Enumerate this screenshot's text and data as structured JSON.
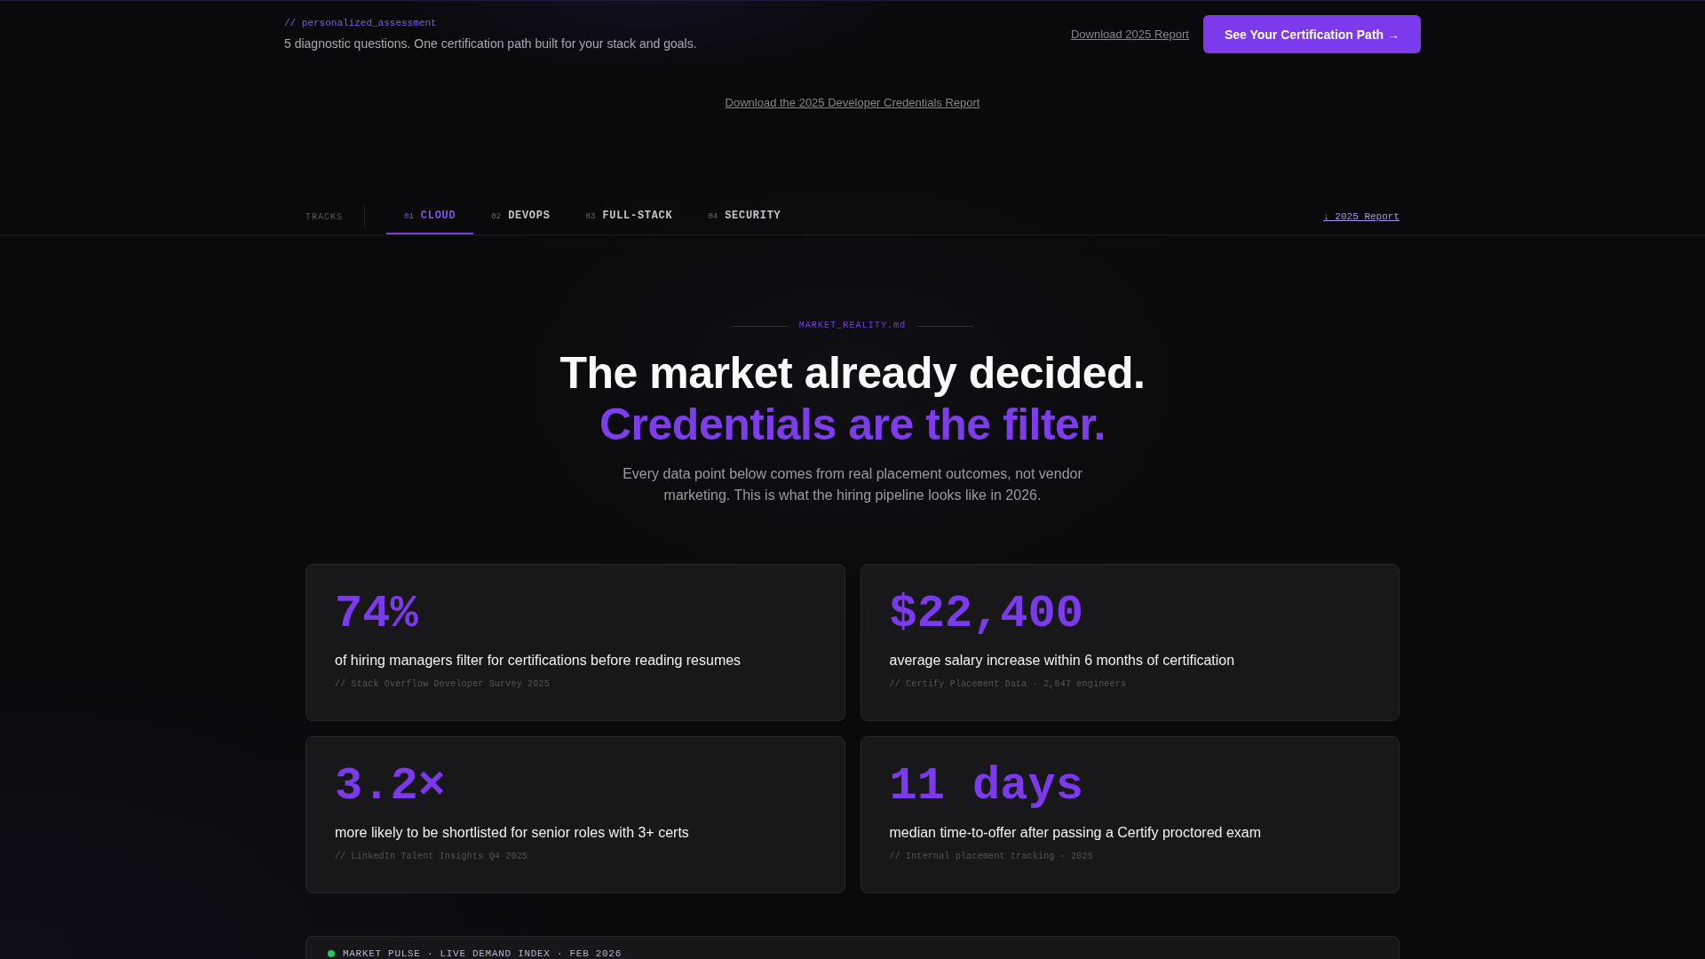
{
  "top_bar": {
    "eyebrow": "// personalized_assessment",
    "subtitle": "5 diagnostic questions. One certification path built for your stack and goals.",
    "link": "Download 2025 Report",
    "button": "See Your Certification Path →"
  },
  "report_link": "Download the 2025 Developer Credentials Report",
  "tracks": {
    "label": "TRACKS",
    "tabs": [
      {
        "number": "01",
        "label": "CLOUD",
        "selected": true
      },
      {
        "number": "02",
        "label": "DEVOPS",
        "selected": false
      },
      {
        "number": "03",
        "label": "FULL-STACK",
        "selected": false
      },
      {
        "number": "04",
        "label": "SECURITY",
        "selected": false
      }
    ],
    "report_link": "↓ 2025 Report"
  },
  "hero": {
    "file_label": "MARKET_REALITY.md",
    "headline": "The market already decided.",
    "headline_accent": "Credentials are the filter.",
    "intro": "Every data point below comes from real placement outcomes, not vendor marketing. This is what the hiring pipeline looks like in 2026."
  },
  "stats": [
    {
      "value": "74%",
      "description": "of hiring managers filter for certifications before reading resumes",
      "source": "// Stack Overflow Developer Survey 2025"
    },
    {
      "value": "$22,400",
      "description": "average salary increase within 6 months of certification",
      "source": "// Certify Placement Data · 2,847 engineers"
    },
    {
      "value": "3.2×",
      "description": "more likely to be shortlisted for senior roles with 3+ certs",
      "source": "// LinkedIn Talent Insights Q4 2025"
    },
    {
      "value": "11 days",
      "description": "median time-to-offer after passing a Certify proctored exam",
      "source": "// Internal placement tracking · 2025"
    }
  ],
  "market_pulse": {
    "title": "MARKET PULSE · LIVE DEMAND INDEX · FEB 2026"
  }
}
